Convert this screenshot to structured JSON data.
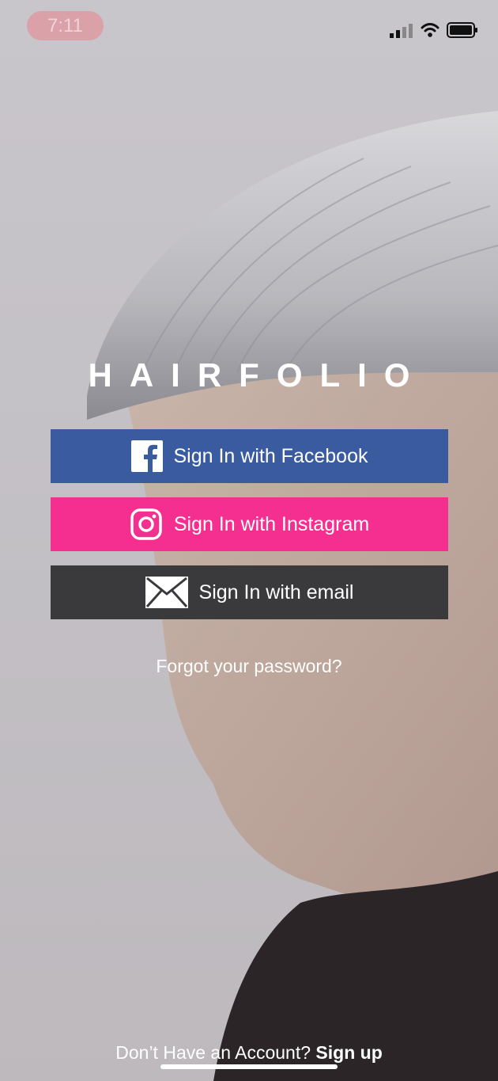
{
  "status_bar": {
    "time": "7:11",
    "signal_icon": "cellular-signal-icon",
    "wifi_icon": "wifi-icon",
    "battery_icon": "battery-icon"
  },
  "logo": {
    "text": "HAIRFOLIO"
  },
  "buttons": {
    "facebook": {
      "label": "Sign In with Facebook",
      "icon": "facebook-icon",
      "color": "#3b5ba1"
    },
    "instagram": {
      "label": "Sign In with Instagram",
      "icon": "instagram-icon",
      "color": "#f52f8f"
    },
    "email": {
      "label": "Sign In with email",
      "icon": "envelope-icon",
      "color": "#3a393c"
    }
  },
  "forgot_password": {
    "label": "Forgot your password?"
  },
  "footer": {
    "prompt": "Don’t Have an Account?",
    "signup_label": "Sign up"
  }
}
